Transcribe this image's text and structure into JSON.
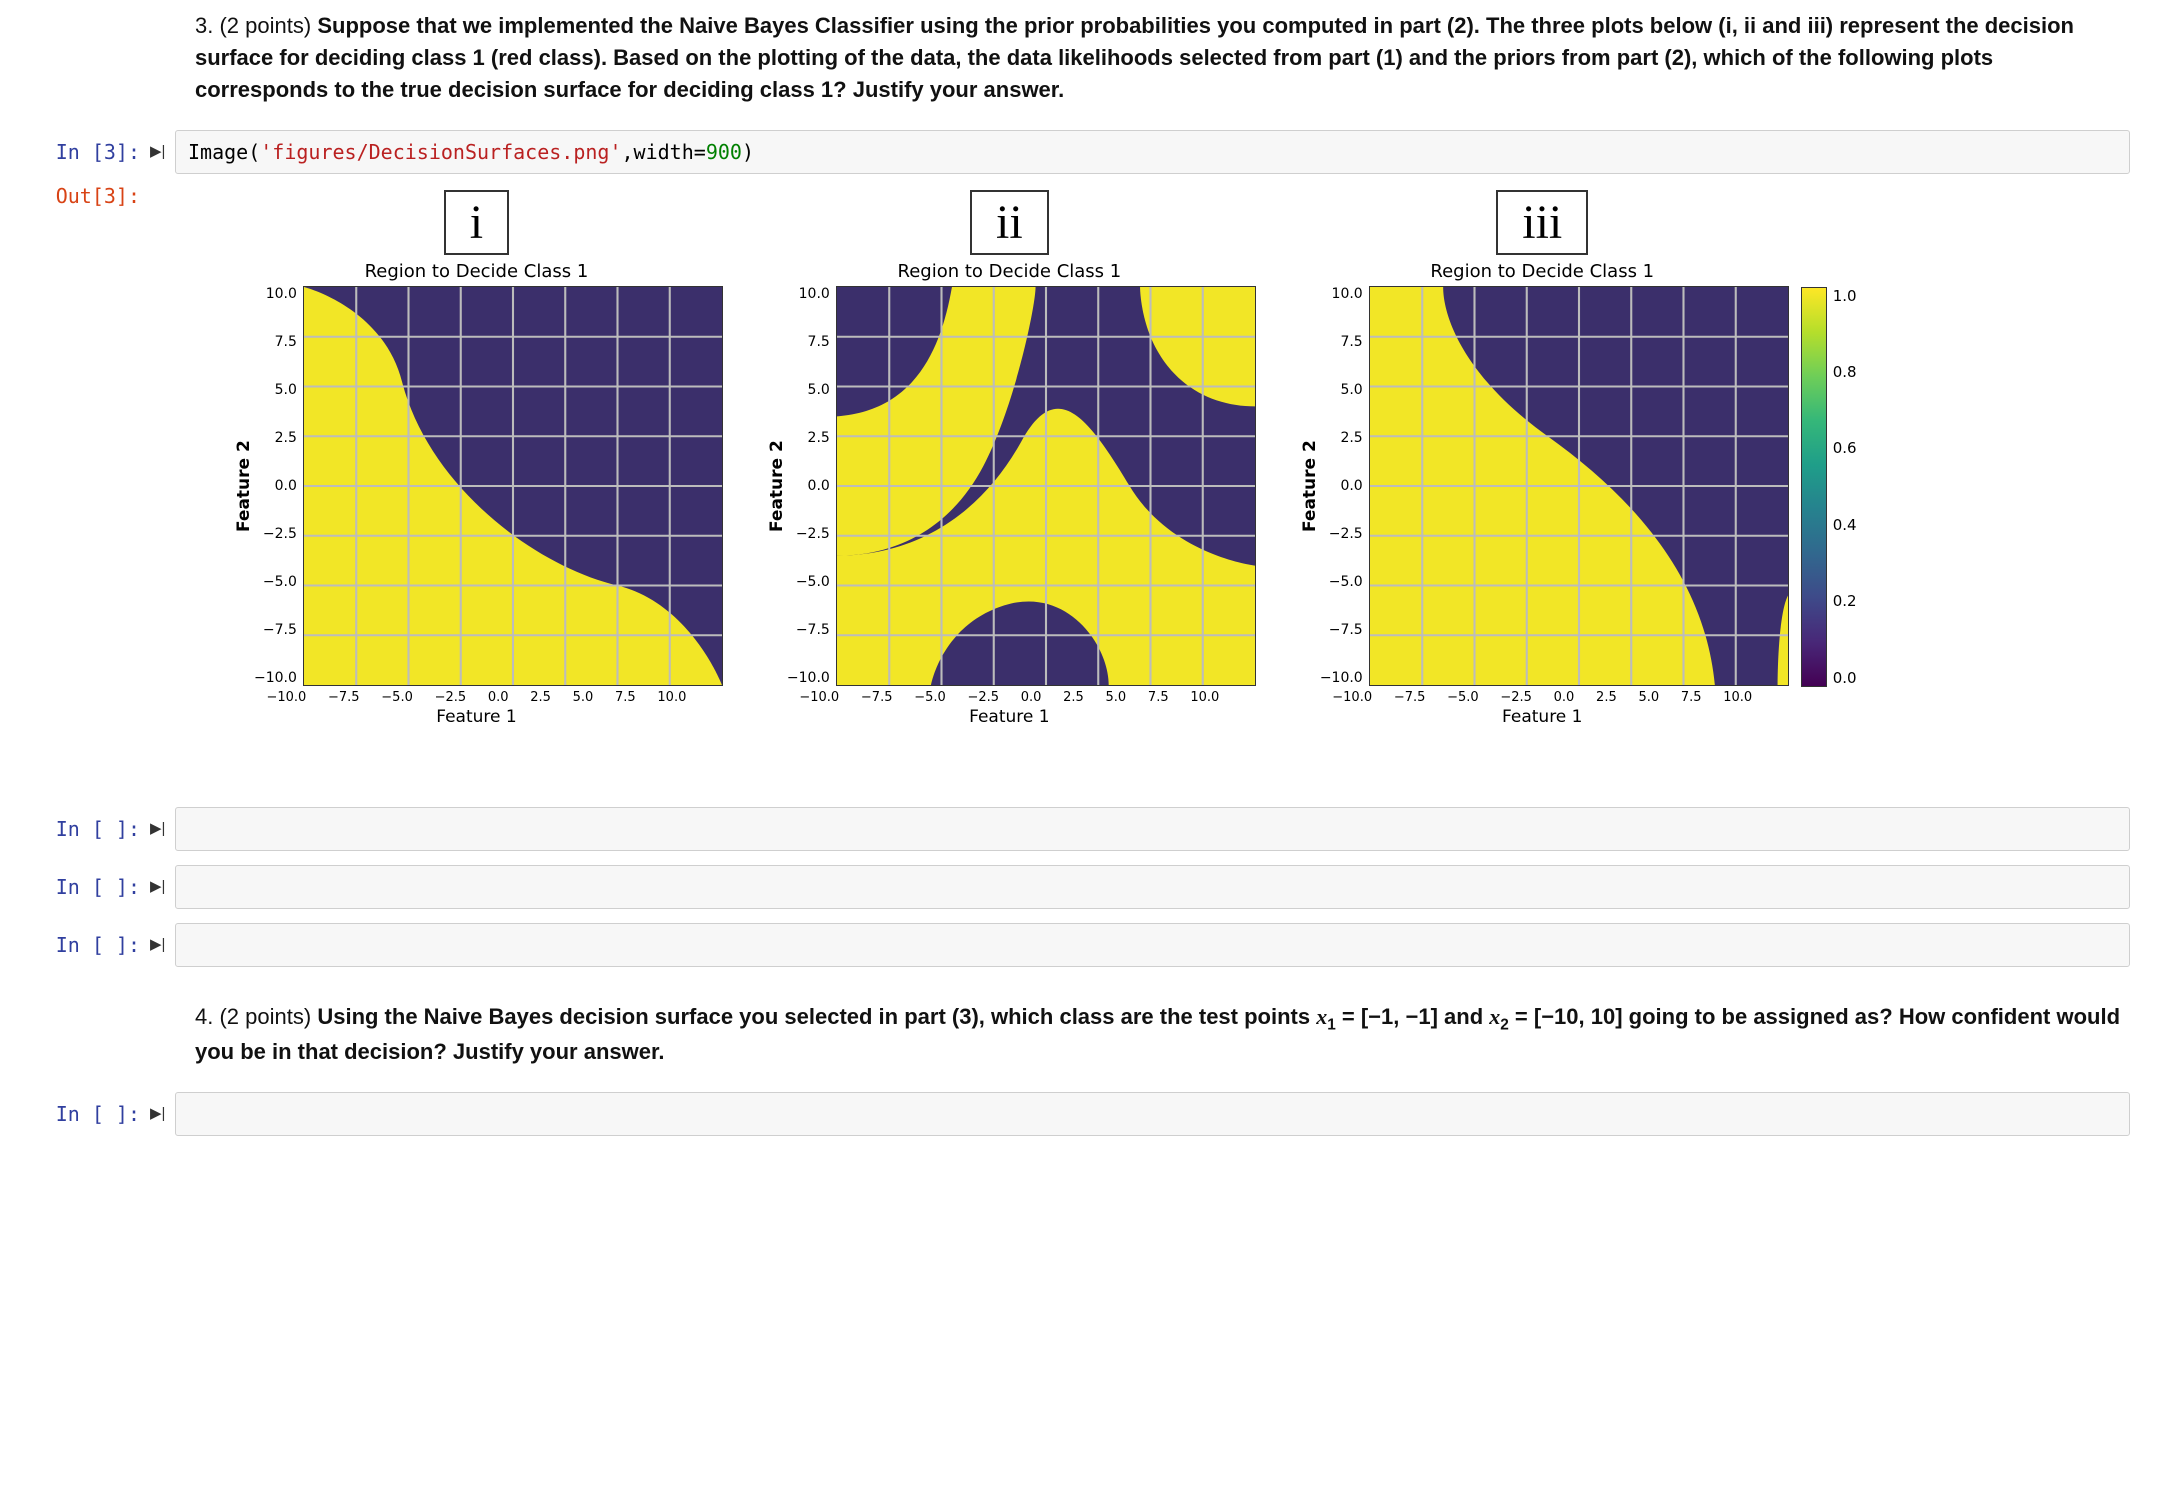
{
  "question3": {
    "number": "3.",
    "points": "(2 points)",
    "text": "Suppose that we implemented the Naive Bayes Classifier using the prior probabilities you computed in part (2). The three plots below (i, ii and iii) represent the decision surface for deciding class 1 (red class). Based on the plotting of the data, the data likelihoods selected from part (1) and the priors from part (2), which of the following plots corresponds to the true decision surface for deciding class 1? Justify your answer."
  },
  "cell_code": {
    "prompt": "In [3]:",
    "run_glyph": "▶|",
    "code_func": "Image",
    "code_open": "(",
    "code_str": "'figures/DecisionSurfaces.png'",
    "code_sep": ",",
    "code_kw": "width",
    "code_eq": "=",
    "code_num": "900",
    "code_close": ")"
  },
  "cell_out": {
    "prompt": "Out[3]:"
  },
  "plots": {
    "common_title": "Region to Decide Class 1",
    "ylabel": "Feature 2",
    "xlabel": "Feature 1",
    "yticks": [
      "10.0",
      "7.5",
      "5.0",
      "2.5",
      "0.0",
      "−2.5",
      "−5.0",
      "−7.5",
      "−10.0"
    ],
    "xticks": [
      "−10.0",
      "−7.5",
      "−5.0",
      "−2.5",
      "0.0",
      "2.5",
      "5.0",
      "7.5",
      "10.0"
    ],
    "labels": {
      "i": "i",
      "ii": "ii",
      "iii": "iii"
    }
  },
  "colorbar": {
    "ticks": [
      "1.0",
      "0.8",
      "0.6",
      "0.4",
      "0.2",
      "0.0"
    ]
  },
  "empty_prompt": "In [ ]:",
  "question4": {
    "number": "4.",
    "points": "(2 points)",
    "prefix": "Using the Naive Bayes decision surface you selected in part (3), which class are the test points ",
    "x1": "x",
    "x1sub": "1",
    "eq": " = [−1, −1]",
    "and": " and ",
    "x2": "x",
    "x2sub": "2",
    "eq2": " = [−10, 10]",
    "suffix": " going to be assigned as? How confident would you be in that decision? Justify your answer."
  },
  "chart_data": [
    {
      "id": "i",
      "type": "heatmap",
      "title": "Region to Decide Class 1",
      "xlabel": "Feature 1",
      "ylabel": "Feature 2",
      "xlim": [
        -10,
        10
      ],
      "ylim": [
        -10,
        10
      ],
      "description": "Binary decision region. Yellow (class 1) covers the lower-left quadrant bounded roughly by a quarter-circle of radius ~10 centered near (-10,-10); purple elsewhere.",
      "legend": {
        "yellow": 1,
        "purple": 0
      }
    },
    {
      "id": "ii",
      "type": "heatmap",
      "title": "Region to Decide Class 1",
      "xlabel": "Feature 1",
      "ylabel": "Feature 2",
      "xlim": [
        -10,
        10
      ],
      "ylim": [
        -10,
        10
      ],
      "description": "Binary decision region. Yellow (class 1) forms a diagonal S-shaped band from lower-left to upper-right; purple in the upper-left and lower regions outside the band.",
      "legend": {
        "yellow": 1,
        "purple": 0
      }
    },
    {
      "id": "iii",
      "type": "heatmap",
      "title": "Region to Decide Class 1",
      "xlabel": "Feature 1",
      "ylabel": "Feature 2",
      "xlim": [
        -10,
        10
      ],
      "ylim": [
        -10,
        10
      ],
      "description": "Binary decision region. Yellow (class 1) occupies the lower-left triangular half below a curved anti-diagonal boundary; purple occupies the upper-right half.",
      "legend": {
        "yellow": 1,
        "purple": 0
      }
    }
  ]
}
